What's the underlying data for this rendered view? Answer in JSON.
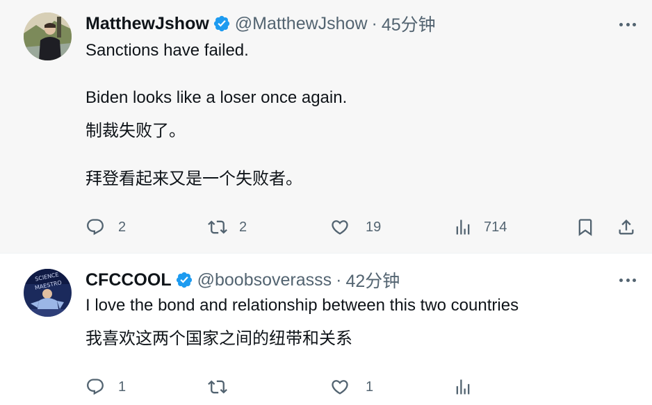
{
  "tweets": [
    {
      "display_name": "MatthewJshow",
      "handle": "@MatthewJshow",
      "separator": "·",
      "time": "45分钟",
      "lines": [
        "Sanctions have failed.",
        "Biden looks like a loser once again.",
        "制裁失败了。",
        "拜登看起来又是一个失败者。"
      ],
      "replies": "2",
      "retweets": "2",
      "likes": "19",
      "views": "714"
    },
    {
      "display_name": "CFCCOOL",
      "handle": "@boobsoverasss",
      "separator": "·",
      "time": "42分钟",
      "lines": [
        "I love the bond and relationship between this two countries",
        "我喜欢这两个国家之间的纽带和关系"
      ],
      "replies": "1",
      "retweets": "",
      "likes": "1",
      "views": ""
    }
  ],
  "colors": {
    "verified": "#1d9bf0",
    "secondary_text": "#536471",
    "primary_text": "#0f1419"
  },
  "icons": [
    "verified-badge-icon",
    "more-icon",
    "reply-icon",
    "retweet-icon",
    "like-icon",
    "views-icon",
    "bookmark-icon",
    "share-icon"
  ]
}
